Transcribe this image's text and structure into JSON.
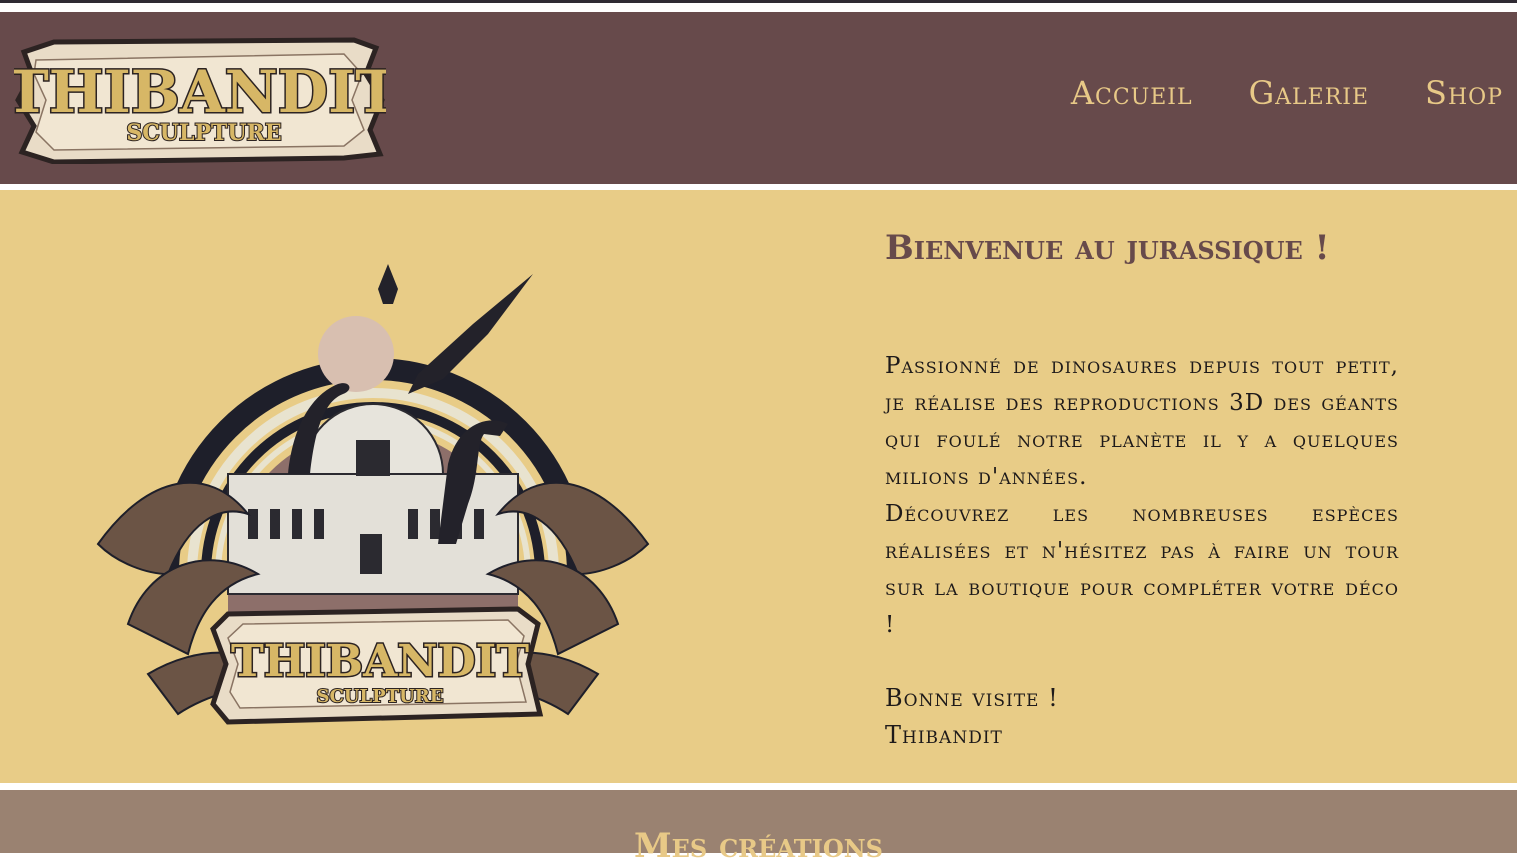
{
  "header": {
    "logo": {
      "title": "THIBANDIT",
      "subtitle": "SCULPTURE"
    },
    "nav": [
      "Accueil",
      "Galerie",
      "Shop"
    ]
  },
  "hero": {
    "title": "Bienvenue au jurassique !",
    "intro_p1": "Passionné de dinosaures depuis tout petit, je réalise des reproductions 3D des géants qui foulé notre planète il y a quelques milions d'années.",
    "intro_p2": "Découvrez les nombreuses espèces réalisées et n'hésitez pas à faire un tour sur la boutique pour compléter votre déco !",
    "sign_greeting": "Bonne visite !",
    "sign_name": "Thibandit",
    "emblem": {
      "title": "THIBANDIT",
      "subtitle": "SCULPTURE"
    }
  },
  "creations": {
    "title": "Mes créations"
  },
  "colors": {
    "header_bg": "#674a4b",
    "nav_text": "#e8c987",
    "hero_bg": "#e8cc87",
    "creations_bg": "#9a8271"
  }
}
